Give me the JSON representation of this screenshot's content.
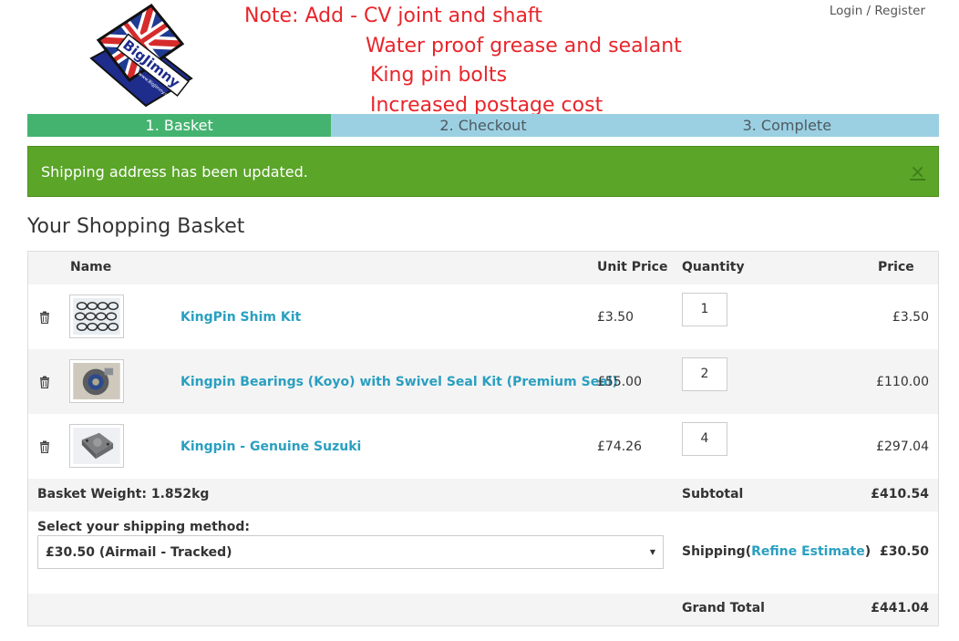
{
  "annotations": {
    "line1": "Note: Add - CV joint and shaft",
    "line2": "Water proof grease and sealant",
    "line3": "King pin bolts",
    "line4": "Increased postage cost"
  },
  "logo": {
    "text": "BigJimny",
    "small_text": "www.BigJimny.com"
  },
  "header": {
    "login_label": "Login",
    "separator": "/",
    "register_label": "Register"
  },
  "steps": [
    {
      "label": "1. Basket",
      "state": "active"
    },
    {
      "label": "2. Checkout",
      "state": "todo"
    },
    {
      "label": "3. Complete",
      "state": "todo"
    }
  ],
  "alert": {
    "message": "Shipping address has been updated.",
    "close_symbol": "×"
  },
  "basket": {
    "title": "Your Shopping Basket",
    "columns": {
      "name": "Name",
      "unit_price": "Unit Price",
      "quantity": "Quantity",
      "price": "Price"
    },
    "items": [
      {
        "name": "KingPin Shim Kit",
        "unit_price": "£3.50",
        "quantity": "1",
        "price": "£3.50",
        "thumb_icon": "shim-rings-icon"
      },
      {
        "name": "Kingpin Bearings (Koyo) with Swivel Seal Kit (Premium Seal)",
        "unit_price": "£55.00",
        "quantity": "2",
        "price": "£110.00",
        "thumb_icon": "bearing-icon"
      },
      {
        "name": "Kingpin - Genuine Suzuki",
        "unit_price": "£74.26",
        "quantity": "4",
        "price": "£297.04",
        "thumb_icon": "kingpin-icon"
      }
    ],
    "weight_label": "Basket Weight: 1.852kg",
    "subtotal_label": "Subtotal",
    "subtotal_value": "£410.54",
    "shipping_method_label": "Select your shipping method:",
    "shipping_method_value": "£30.50 (Airmail - Tracked)",
    "shipping_label": "Shipping",
    "shipping_open_paren": "(",
    "refine_label": "Refine Estimate",
    "shipping_close_paren": ")",
    "shipping_value": "£30.50",
    "grand_total_label": "Grand Total",
    "grand_total_value": "£441.04"
  },
  "colors": {
    "step_active": "#45b370",
    "step_todo": "#9bd0e3",
    "alert_bg": "#5ba529",
    "link": "#2a9fc0",
    "annotation": "#e8252b"
  }
}
